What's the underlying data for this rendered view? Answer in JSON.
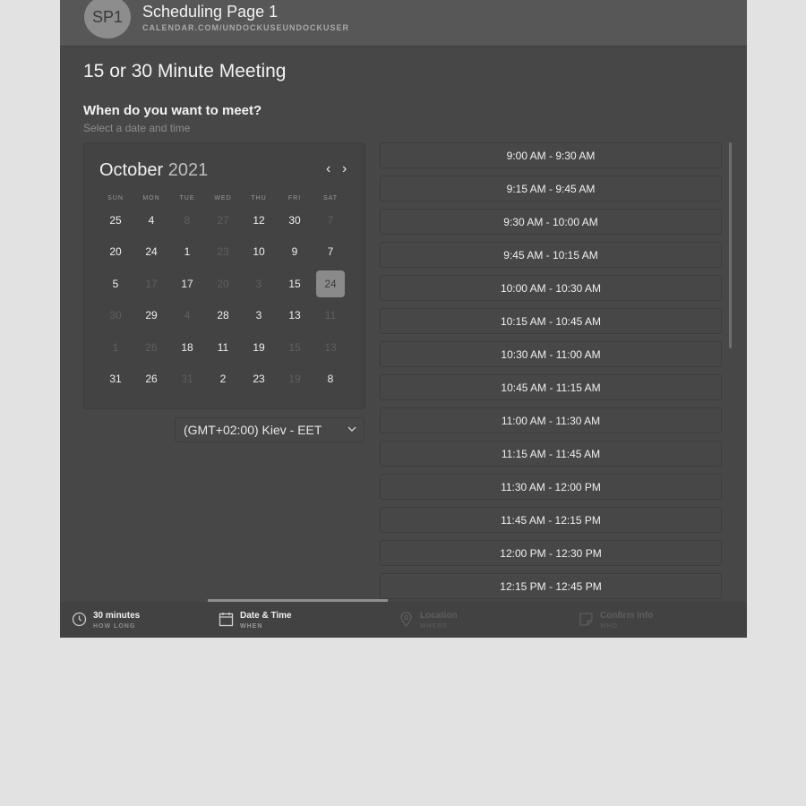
{
  "header": {
    "avatar_text": "SP1",
    "title": "Scheduling Page 1",
    "url": "CALENDAR.COM/UNDOCKUSEUNDOCKUSER"
  },
  "main": {
    "meeting_title": "15 or 30 Minute Meeting",
    "question": "When do you want to meet?",
    "subtitle": "Select a date and time"
  },
  "calendar": {
    "month": "October",
    "year": "2021",
    "prev_icon": "‹",
    "next_icon": "›",
    "weekdays": [
      "SUN",
      "MON",
      "TUE",
      "WED",
      "THU",
      "FRI",
      "SAT"
    ],
    "weeks": [
      [
        {
          "d": "25",
          "dim": false
        },
        {
          "d": "4",
          "dim": false
        },
        {
          "d": "8",
          "dim": true
        },
        {
          "d": "27",
          "dim": true
        },
        {
          "d": "12",
          "dim": false
        },
        {
          "d": "30",
          "dim": false
        },
        {
          "d": "7",
          "dim": true
        }
      ],
      [
        {
          "d": "20",
          "dim": false
        },
        {
          "d": "24",
          "dim": false
        },
        {
          "d": "1",
          "dim": false
        },
        {
          "d": "23",
          "dim": true
        },
        {
          "d": "10",
          "dim": false
        },
        {
          "d": "9",
          "dim": false
        },
        {
          "d": "7",
          "dim": false
        }
      ],
      [
        {
          "d": "5",
          "dim": false
        },
        {
          "d": "17",
          "dim": true
        },
        {
          "d": "17",
          "dim": false
        },
        {
          "d": "20",
          "dim": true
        },
        {
          "d": "3",
          "dim": true
        },
        {
          "d": "15",
          "dim": false
        },
        {
          "d": "24",
          "dim": false,
          "selected": true
        }
      ],
      [
        {
          "d": "30",
          "dim": true
        },
        {
          "d": "29",
          "dim": false
        },
        {
          "d": "4",
          "dim": true
        },
        {
          "d": "28",
          "dim": false
        },
        {
          "d": "3",
          "dim": false
        },
        {
          "d": "13",
          "dim": false
        },
        {
          "d": "11",
          "dim": true
        }
      ],
      [
        {
          "d": "1",
          "dim": true
        },
        {
          "d": "26",
          "dim": true
        },
        {
          "d": "18",
          "dim": false
        },
        {
          "d": "11",
          "dim": false
        },
        {
          "d": "19",
          "dim": false
        },
        {
          "d": "15",
          "dim": true
        },
        {
          "d": "13",
          "dim": true
        }
      ],
      [
        {
          "d": "31",
          "dim": false
        },
        {
          "d": "26",
          "dim": false
        },
        {
          "d": "31",
          "dim": true
        },
        {
          "d": "2",
          "dim": false
        },
        {
          "d": "23",
          "dim": false
        },
        {
          "d": "19",
          "dim": true
        },
        {
          "d": "8",
          "dim": false
        }
      ]
    ]
  },
  "timezone": {
    "label": "(GMT+02:00) Kiev - EET",
    "icon": "chevron-down-icon"
  },
  "time_slots": [
    "9:00 AM - 9:30 AM",
    "9:15 AM - 9:45 AM",
    "9:30 AM - 10:00 AM",
    "9:45 AM - 10:15 AM",
    "10:00 AM - 10:30 AM",
    "10:15 AM - 10:45 AM",
    "10:30 AM - 11:00 AM",
    "10:45 AM - 11:15 AM",
    "11:00 AM - 11:30 AM",
    "11:15 AM - 11:45 AM",
    "11:30 AM - 12:00 PM",
    "11:45 AM - 12:15 PM",
    "12:00 PM - 12:30 PM",
    "12:15 PM - 12:45 PM"
  ],
  "footer": {
    "steps": [
      {
        "label": "30 minutes",
        "sub": "HOW LONG",
        "icon": "clock-icon",
        "state": "done"
      },
      {
        "label": "Date & Time",
        "sub": "WHEN",
        "icon": "calendar-icon",
        "state": "active"
      },
      {
        "label": "Location",
        "sub": "WHERE",
        "icon": "location-pin-icon",
        "state": "pending"
      },
      {
        "label": "Confirm Info",
        "sub": "WHO",
        "icon": "note-icon",
        "state": "pending"
      }
    ]
  },
  "colors": {
    "page_bg": "#e2e2e2",
    "panel_bg": "#474747",
    "header_bg": "#575757",
    "selected_day": "#8a8a8a"
  }
}
